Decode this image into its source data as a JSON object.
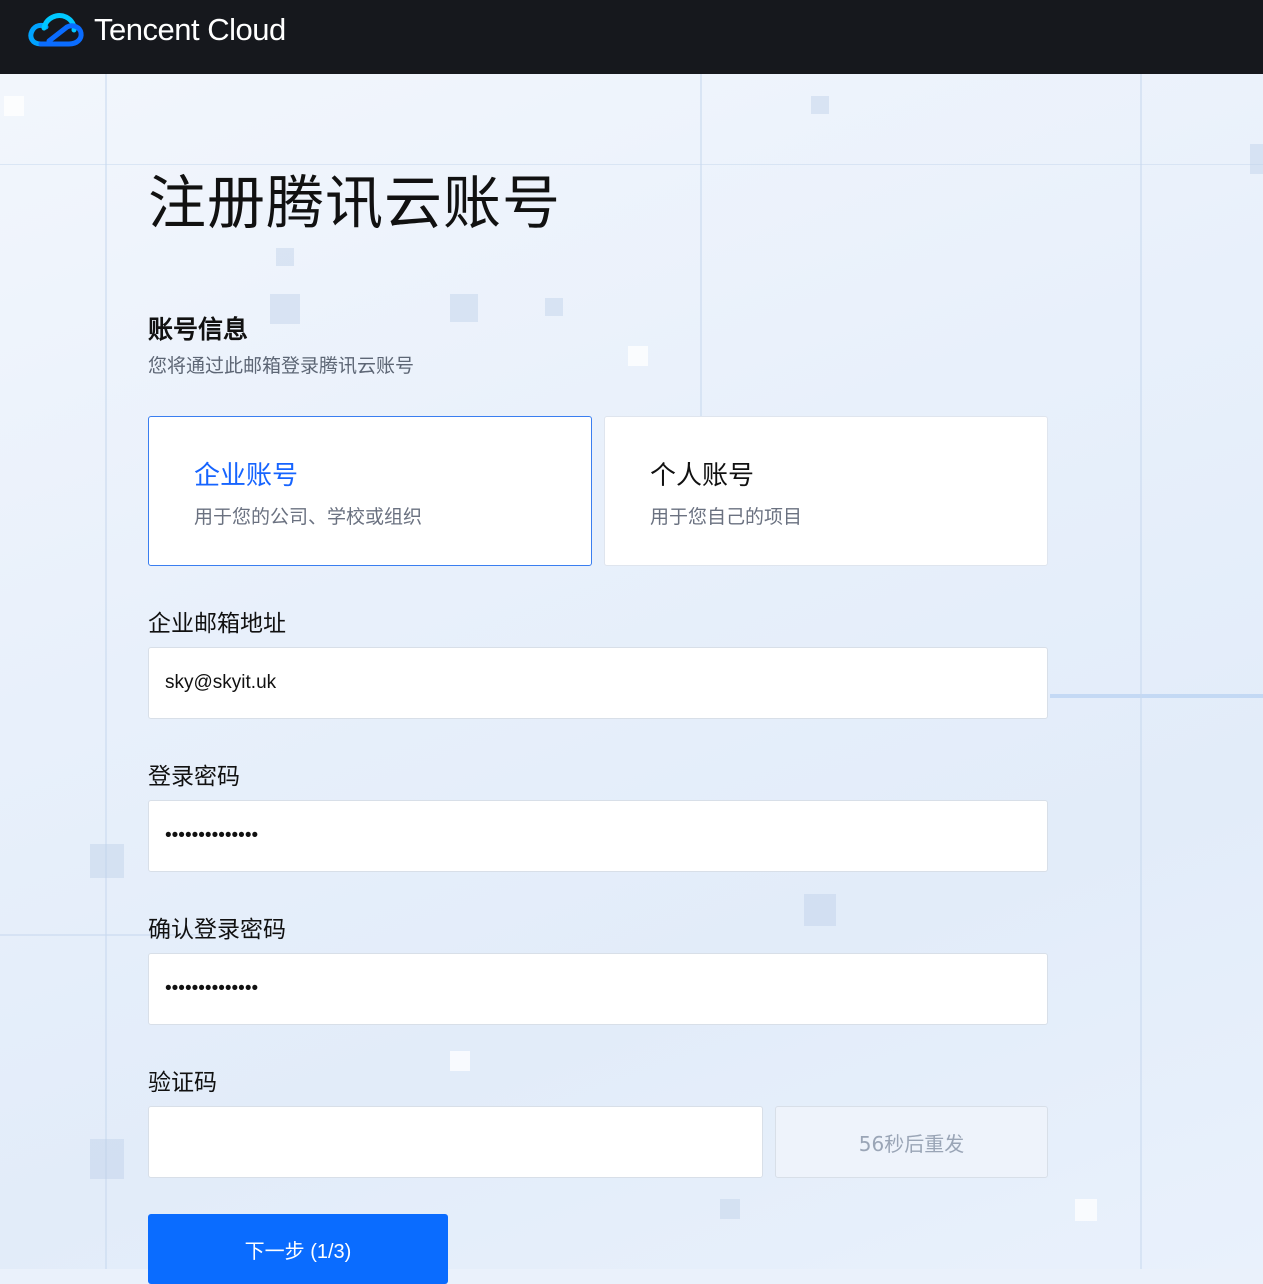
{
  "brand": {
    "name": "Tencent Cloud"
  },
  "page": {
    "title": "注册腾讯云账号"
  },
  "section": {
    "title": "账号信息",
    "subtitle": "您将通过此邮箱登录腾讯云账号"
  },
  "account_types": [
    {
      "title": "企业账号",
      "subtitle": "用于您的公司、学校或组织",
      "selected": true
    },
    {
      "title": "个人账号",
      "subtitle": "用于您自己的项目",
      "selected": false
    }
  ],
  "form": {
    "email": {
      "label": "企业邮箱地址",
      "value": "sky@skyit.uk"
    },
    "password": {
      "label": "登录密码",
      "value": "••••••••••••••"
    },
    "confirm_password": {
      "label": "确认登录密码",
      "value": "••••••••••••••"
    },
    "code": {
      "label": "验证码",
      "value": "",
      "resend": "56秒后重发"
    }
  },
  "actions": {
    "next": "下一步 (1/3)"
  },
  "colors": {
    "accent": "#0a6cff",
    "topbar": "#16181d",
    "selected_border": "#3a7ef0"
  }
}
